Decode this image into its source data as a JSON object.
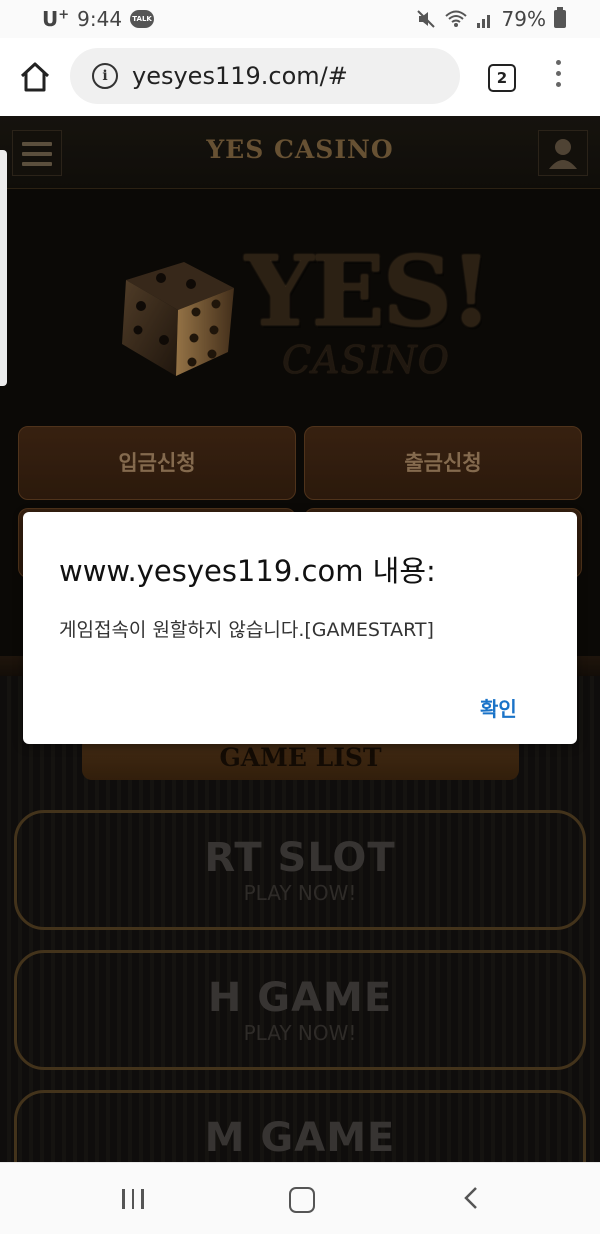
{
  "status_bar": {
    "carrier": "U",
    "carrier_sup": "+",
    "time": "9:44",
    "talk_badge": "TALK",
    "battery": "79%"
  },
  "browser": {
    "url": "yesyes119.com/#",
    "tab_count": "2"
  },
  "site": {
    "title": "YES CASINO",
    "logo_main": "YES!",
    "logo_sub": "CASINO",
    "buttons": {
      "deposit": "입금신청",
      "withdraw": "출금신청"
    },
    "game_list_label": "GAME LIST",
    "games": [
      {
        "name": "RT SLOT",
        "sub": "PLAY NOW!"
      },
      {
        "name": "H GAME",
        "sub": "PLAY NOW!"
      },
      {
        "name": "M GAME",
        "sub": ""
      }
    ]
  },
  "dialog": {
    "title": "www.yesyes119.com 내용:",
    "message": "게임접속이 원할하지 않습니다.[GAMESTART]",
    "ok_label": "확인"
  },
  "colors": {
    "accent_link": "#1a73c8",
    "site_gold": "#8a6d45",
    "button_brown": "#4a2c16"
  }
}
